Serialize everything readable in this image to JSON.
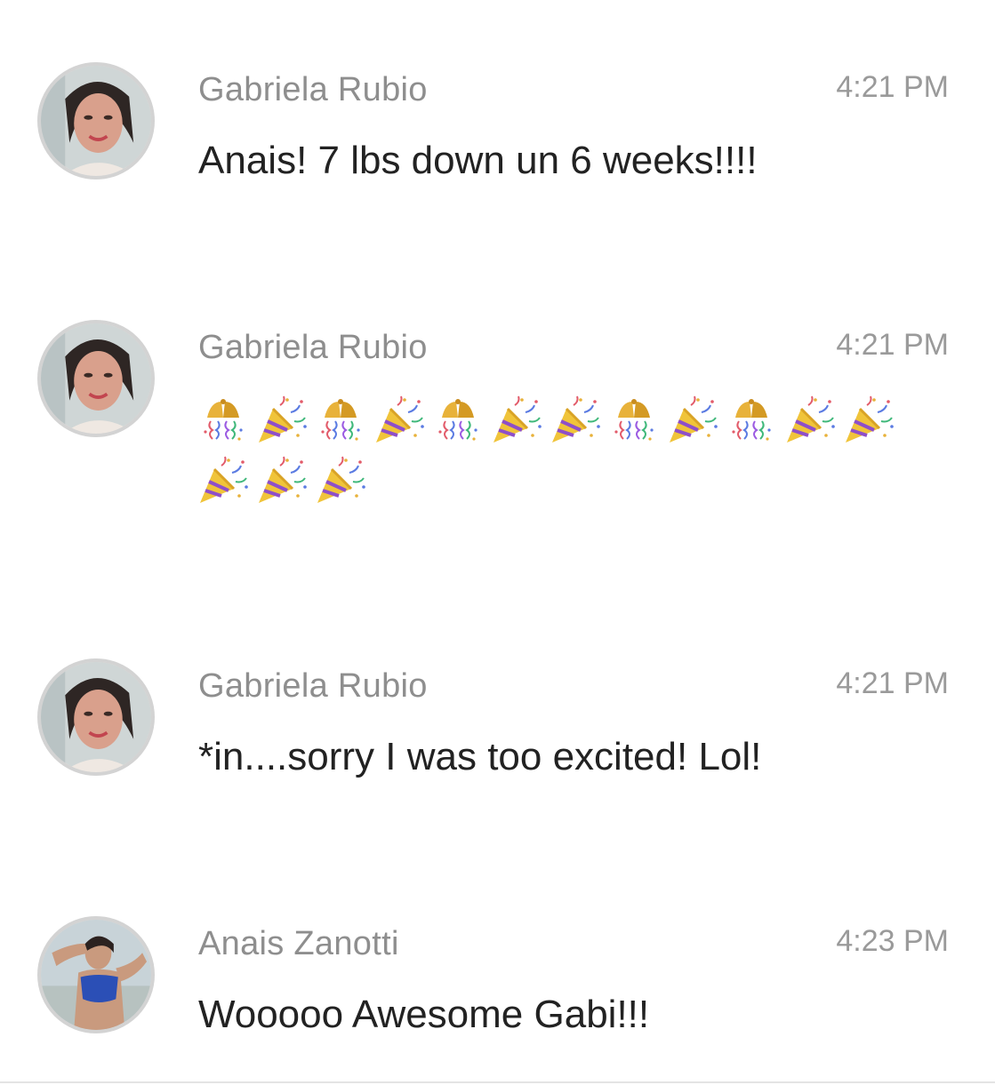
{
  "messages": [
    {
      "sender": "Gabriela Rubio",
      "time": "4:21 PM",
      "text": "Anais! 7 lbs down un 6 weeks!!!!",
      "avatar": "gabriela-avatar"
    },
    {
      "sender": "Gabriela Rubio",
      "time": "4:21 PM",
      "emoji_sequence": [
        "confetti-ball",
        "party-popper",
        "confetti-ball",
        "party-popper",
        "confetti-ball",
        "party-popper",
        "party-popper",
        "confetti-ball",
        "party-popper",
        "confetti-ball",
        "party-popper",
        "party-popper",
        "party-popper",
        "party-popper",
        "party-popper"
      ],
      "avatar": "gabriela-avatar"
    },
    {
      "sender": "Gabriela Rubio",
      "time": "4:21 PM",
      "text": "*in....sorry I was too excited! Lol!",
      "avatar": "gabriela-avatar"
    },
    {
      "sender": "Anais Zanotti",
      "time": "4:23 PM",
      "text": "Wooooo Awesome Gabi!!!",
      "avatar": "anais-avatar"
    }
  ],
  "colors": {
    "background": "#ffffff",
    "sender": "#8e8e8e",
    "timestamp": "#9a9a9a",
    "body_text": "#222222",
    "avatar_ring": "#d3d3d3"
  }
}
